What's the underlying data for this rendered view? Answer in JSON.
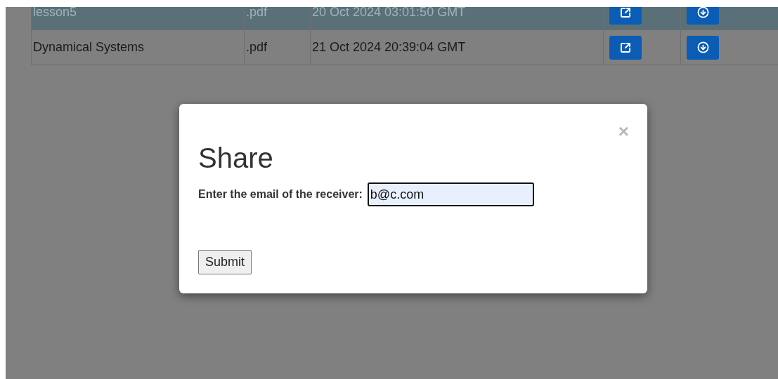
{
  "files_table": {
    "rows": [
      {
        "name": "lesson5",
        "extension": ".pdf",
        "date": "20 Oct 2024 03:01:50 GMT",
        "selected": true
      },
      {
        "name": "Dynamical Systems",
        "extension": ".pdf",
        "date": "21 Oct 2024 20:39:04 GMT",
        "selected": false
      }
    ]
  },
  "share_dialog": {
    "close": "×",
    "title": "Share",
    "label": "Enter the email of the receiver:",
    "email": "b@c.com",
    "submit": "Submit"
  }
}
